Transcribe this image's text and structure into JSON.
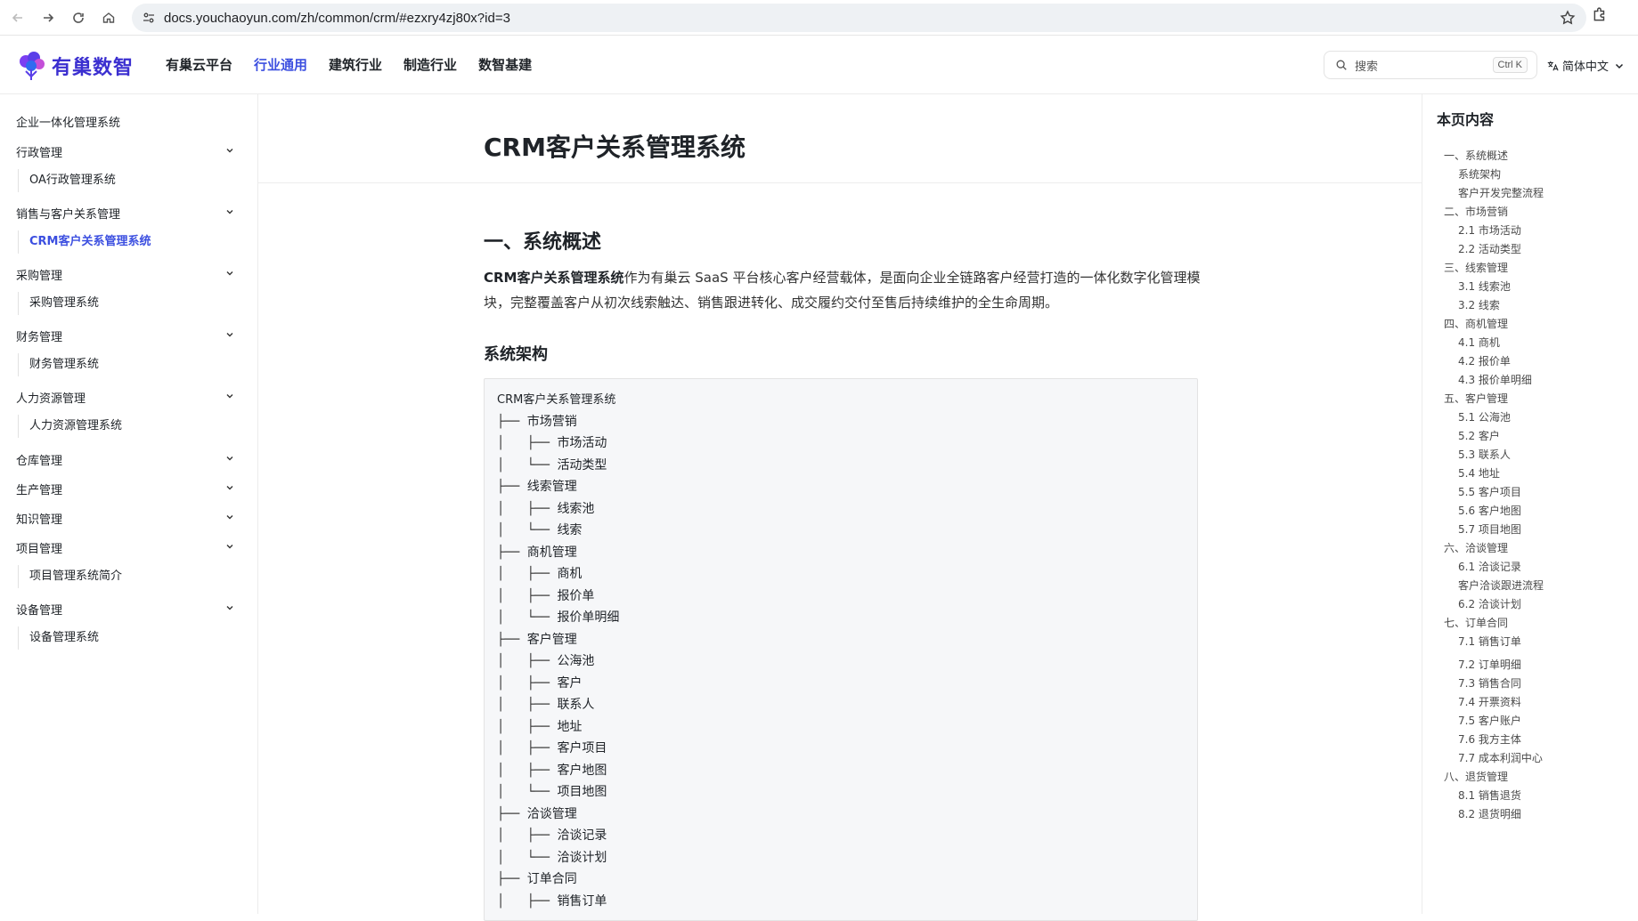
{
  "browser": {
    "url": "docs.youchaoyun.com/zh/common/crm/#ezxry4zj80x?id=3"
  },
  "header": {
    "logo_text": "有巢数智",
    "nav": [
      "有巢云平台",
      "行业通用",
      "建筑行业",
      "制造行业",
      "数智基建"
    ],
    "active_nav": "行业通用",
    "search_placeholder": "搜索",
    "search_shortcut": "Ctrl K",
    "language": "简体中文"
  },
  "sidebar": {
    "items": [
      {
        "label": "企业一体化管理系统",
        "type": "top",
        "expandable": false
      },
      {
        "label": "行政管理",
        "type": "top",
        "expandable": true
      },
      {
        "label": "OA行政管理系统",
        "type": "sub"
      },
      {
        "label": "销售与客户关系管理",
        "type": "top",
        "expandable": true
      },
      {
        "label": "CRM客户关系管理系统",
        "type": "sub",
        "active": true
      },
      {
        "label": "采购管理",
        "type": "top",
        "expandable": true
      },
      {
        "label": "采购管理系统",
        "type": "sub"
      },
      {
        "label": "财务管理",
        "type": "top",
        "expandable": true
      },
      {
        "label": "财务管理系统",
        "type": "sub"
      },
      {
        "label": "人力资源管理",
        "type": "top",
        "expandable": true
      },
      {
        "label": "人力资源管理系统",
        "type": "sub"
      },
      {
        "label": "仓库管理",
        "type": "top",
        "expandable": true
      },
      {
        "label": "生产管理",
        "type": "top",
        "expandable": true
      },
      {
        "label": "知识管理",
        "type": "top",
        "expandable": true
      },
      {
        "label": "项目管理",
        "type": "top",
        "expandable": true
      },
      {
        "label": "项目管理系统简介",
        "type": "sub"
      },
      {
        "label": "设备管理",
        "type": "top",
        "expandable": true
      },
      {
        "label": "设备管理系统",
        "type": "sub"
      }
    ]
  },
  "main": {
    "title": "CRM客户关系管理系统",
    "section_heading": "一、系统概述",
    "intro_bold": "CRM客户关系管理系统",
    "intro_text": "作为有巢云 SaaS 平台核心客户经营载体，是面向企业全链路客户经营打造的一体化数字化管理模块，完整覆盖客户从初次线索触达、销售跟进转化、成交履约交付至售后持续维护的全生命周期。",
    "subheading": "系统架构",
    "tree": [
      {
        "prefix": "",
        "text": "CRM客户关系管理系统"
      },
      {
        "prefix": "├── ",
        "text": "市场营销"
      },
      {
        "prefix": "│   ├── ",
        "text": "市场活动"
      },
      {
        "prefix": "│   └── ",
        "text": "活动类型"
      },
      {
        "prefix": "├── ",
        "text": "线索管理"
      },
      {
        "prefix": "│   ├── ",
        "text": "线索池"
      },
      {
        "prefix": "│   └── ",
        "text": "线索"
      },
      {
        "prefix": "├── ",
        "text": "商机管理"
      },
      {
        "prefix": "│   ├── ",
        "text": "商机"
      },
      {
        "prefix": "│   ├── ",
        "text": "报价单"
      },
      {
        "prefix": "│   └── ",
        "text": "报价单明细"
      },
      {
        "prefix": "├── ",
        "text": "客户管理"
      },
      {
        "prefix": "│   ├── ",
        "text": "公海池"
      },
      {
        "prefix": "│   ├── ",
        "text": "客户"
      },
      {
        "prefix": "│   ├── ",
        "text": "联系人"
      },
      {
        "prefix": "│   ├── ",
        "text": "地址"
      },
      {
        "prefix": "│   ├── ",
        "text": "客户项目"
      },
      {
        "prefix": "│   ├── ",
        "text": "客户地图"
      },
      {
        "prefix": "│   └── ",
        "text": "项目地图"
      },
      {
        "prefix": "├── ",
        "text": "洽谈管理"
      },
      {
        "prefix": "│   ├── ",
        "text": "洽谈记录"
      },
      {
        "prefix": "│   └── ",
        "text": "洽谈计划"
      },
      {
        "prefix": "├── ",
        "text": "订单合同"
      },
      {
        "prefix": "│   ├── ",
        "text": "销售订单"
      }
    ]
  },
  "toc": {
    "title": "本页内容",
    "items": [
      {
        "label": "一、系统概述",
        "level": 1
      },
      {
        "label": "系统架构",
        "level": 2
      },
      {
        "label": "客户开发完整流程",
        "level": 2
      },
      {
        "label": "二、市场营销",
        "level": 1
      },
      {
        "label": "2.1 市场活动",
        "level": 2
      },
      {
        "label": "2.2 活动类型",
        "level": 2
      },
      {
        "label": "三、线索管理",
        "level": 1
      },
      {
        "label": "3.1 线索池",
        "level": 2
      },
      {
        "label": "3.2 线索",
        "level": 2
      },
      {
        "label": "四、商机管理",
        "level": 1
      },
      {
        "label": "4.1 商机",
        "level": 2
      },
      {
        "label": "4.2 报价单",
        "level": 2
      },
      {
        "label": "4.3 报价单明细",
        "level": 2
      },
      {
        "label": "五、客户管理",
        "level": 1
      },
      {
        "label": "5.1 公海池",
        "level": 2
      },
      {
        "label": "5.2 客户",
        "level": 2
      },
      {
        "label": "5.3 联系人",
        "level": 2
      },
      {
        "label": "5.4 地址",
        "level": 2
      },
      {
        "label": "5.5 客户项目",
        "level": 2
      },
      {
        "label": "5.6 客户地图",
        "level": 2
      },
      {
        "label": "5.7 项目地图",
        "level": 2
      },
      {
        "label": "六、洽谈管理",
        "level": 1
      },
      {
        "label": "6.1 洽谈记录",
        "level": 2
      },
      {
        "label": "客户洽谈跟进流程",
        "level": 2
      },
      {
        "label": "6.2 洽谈计划",
        "level": 2
      },
      {
        "label": "七、订单合同",
        "level": 1
      },
      {
        "label": "7.1 销售订单",
        "level": 2
      },
      {
        "label": "7.2 订单明细",
        "level": 2
      },
      {
        "label": "7.3 销售合同",
        "level": 2
      },
      {
        "label": "7.4 开票资料",
        "level": 2
      },
      {
        "label": "7.5 客户账户",
        "level": 2
      },
      {
        "label": "7.6 我方主体",
        "level": 2
      },
      {
        "label": "7.7 成本利润中心",
        "level": 2
      },
      {
        "label": "八、退货管理",
        "level": 1
      },
      {
        "label": "8.1 销售退货",
        "level": 2
      },
      {
        "label": "8.2 退货明细",
        "level": 2
      }
    ]
  },
  "colors": {
    "accent": "#3c4fe0",
    "logo": "#3b2fd0",
    "code_bg": "#f6f7f9"
  }
}
